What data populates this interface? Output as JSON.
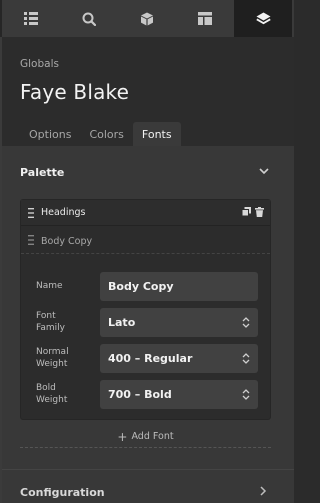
{
  "toolbar": {
    "buttons": [
      {
        "icon": "list-icon"
      },
      {
        "icon": "search-icon"
      },
      {
        "icon": "cube-icon"
      },
      {
        "icon": "layout-icon"
      },
      {
        "icon": "layers-icon",
        "active": true
      }
    ]
  },
  "header": {
    "breadcrumb": "Globals",
    "title": "Faye Blake"
  },
  "tabs": [
    {
      "label": "Options",
      "active": false
    },
    {
      "label": "Colors",
      "active": false
    },
    {
      "label": "Fonts",
      "active": true
    }
  ],
  "palette": {
    "title": "Palette",
    "items": [
      {
        "label": "Headings"
      },
      {
        "label": "Body Copy",
        "expanded": true
      }
    ],
    "editor": {
      "fields": [
        {
          "label_line1": "Name",
          "label_line2": "",
          "value": "Body Copy",
          "type": "text"
        },
        {
          "label_line1": "Font",
          "label_line2": "Family",
          "value": "Lato",
          "type": "select"
        },
        {
          "label_line1": "Normal",
          "label_line2": "Weight",
          "value": "400 – Regular",
          "type": "select"
        },
        {
          "label_line1": "Bold",
          "label_line2": "Weight",
          "value": "700 – Bold",
          "type": "select"
        }
      ]
    },
    "add_label": "Add Font"
  },
  "configuration": {
    "title": "Configuration"
  },
  "colors": {
    "active_tab_bg": "#3a3a3a",
    "panel_bg": "#383838",
    "input_bg": "#414141"
  }
}
